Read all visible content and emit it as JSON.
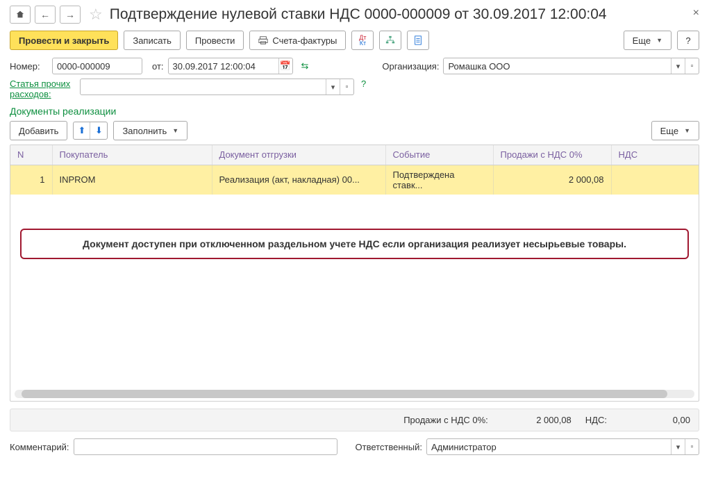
{
  "title": "Подтверждение нулевой ставки НДС 0000-000009 от 30.09.2017 12:00:04",
  "toolbar": {
    "post_close": "Провести и закрыть",
    "save": "Записать",
    "post": "Провести",
    "invoices": "Счета-фактуры",
    "more": "Еще"
  },
  "fields": {
    "number_label": "Номер:",
    "number_value": "0000-000009",
    "date_label": "от:",
    "date_value": "30.09.2017 12:00:04",
    "org_label": "Организация:",
    "org_value": "Ромашка ООО",
    "expense_label1": "Статья прочих",
    "expense_label2": "расходов:",
    "expense_value": ""
  },
  "section_title": "Документы реализации",
  "toolbar2": {
    "add": "Добавить",
    "fill": "Заполнить",
    "more": "Еще"
  },
  "grid": {
    "columns": {
      "n": "N",
      "buyer": "Покупатель",
      "shipment": "Документ отгрузки",
      "event": "Событие",
      "sales0": "Продажи с НДС 0%",
      "vat": "НДС"
    },
    "rows": [
      {
        "n": "1",
        "buyer": "INPROM",
        "shipment": "Реализация (акт, накладная) 00...",
        "event": "Подтверждена ставк...",
        "sales0": "2 000,08",
        "vat": ""
      }
    ]
  },
  "banner": "Документ доступен при отключенном раздельном учете НДС если организация реализует несырьевые товары.",
  "totals": {
    "sales_label": "Продажи с НДС 0%:",
    "sales_value": "2 000,08",
    "vat_label": "НДС:",
    "vat_value": "0,00"
  },
  "footer": {
    "comment_label": "Комментарий:",
    "comment_value": "",
    "responsible_label": "Ответственный:",
    "responsible_value": "Администратор"
  }
}
